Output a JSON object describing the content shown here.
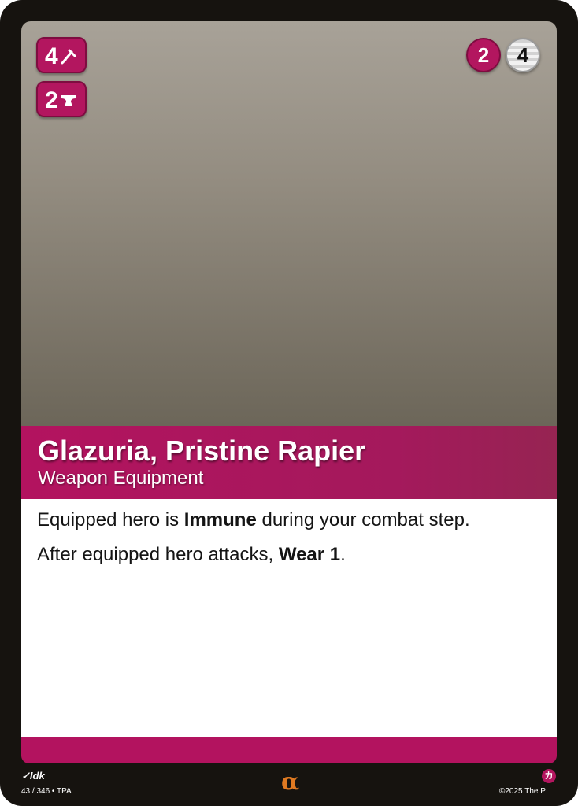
{
  "card": {
    "name": "Glazuria, Pristine Rapier",
    "type_line": "Weapon Equipment",
    "stats": [
      {
        "value": "4",
        "icon": "sword-icon"
      },
      {
        "value": "2",
        "icon": "anvil-icon"
      }
    ],
    "costs": [
      {
        "value": "2",
        "color": "#b3165f"
      },
      {
        "value": "4",
        "color": "#e0e0e0"
      }
    ],
    "rules": [
      {
        "before": "Equipped hero is ",
        "bold": "Immune",
        "after": " during your combat step."
      },
      {
        "before": "After equipped hero attacks, ",
        "bold": "Wear 1",
        "after": "."
      }
    ],
    "accent_color": "#b3135f"
  },
  "footer": {
    "artist": "Idk",
    "set_info": "43 / 346 • TPA",
    "rarity": "α",
    "language": "カ",
    "copyright": "©2025 The P"
  }
}
